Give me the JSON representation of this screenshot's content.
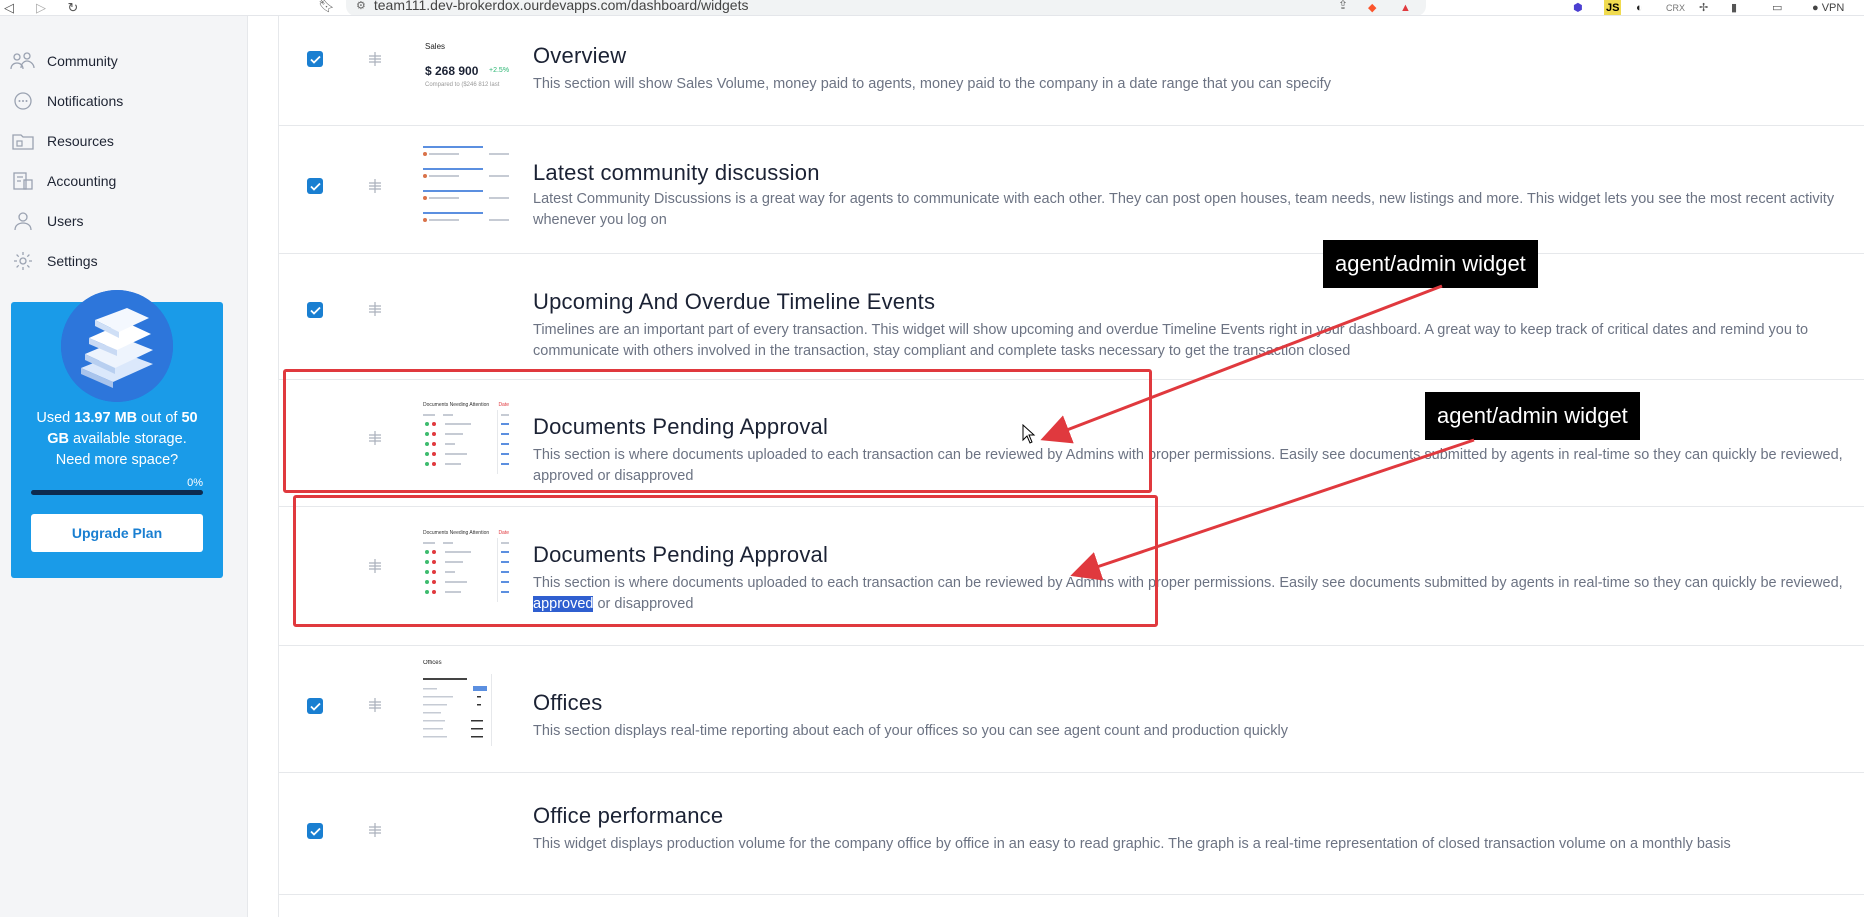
{
  "browser": {
    "url": "team111.dev-brokerdox.ourdevapps.com/dashboard/widgets",
    "vpn_label": "VPN",
    "js_badge": "JS",
    "crx_badge": "CRX"
  },
  "sidebar": {
    "items": [
      {
        "label": "Community",
        "icon": "community-icon"
      },
      {
        "label": "Notifications",
        "icon": "notifications-icon"
      },
      {
        "label": "Resources",
        "icon": "resources-icon"
      },
      {
        "label": "Accounting",
        "icon": "accounting-icon"
      },
      {
        "label": "Users",
        "icon": "users-icon"
      },
      {
        "label": "Settings",
        "icon": "settings-icon"
      }
    ],
    "storage": {
      "prefix": "Used ",
      "used": "13.97 MB",
      "middle": " out of ",
      "total": "50 GB",
      "suffix": " available storage.",
      "need_more": "Need more space?",
      "percent_label": "0%",
      "percent_value": 0,
      "upgrade_label": "Upgrade Plan"
    }
  },
  "widgets": [
    {
      "title": "Overview",
      "description": "This section will show Sales Volume, money paid to agents, money paid to the company in a date range that you can specify",
      "checked": true,
      "thumb": {
        "label": "Sales",
        "value": "$ 268 900",
        "change": "+2.5%",
        "compare": "Compared to ($246 812 last"
      }
    },
    {
      "title": "Latest community discussion",
      "description": "Latest Community Discussions is a great way for agents to communicate with each other. They can post open houses, team needs, new listings and more. This widget lets you see the most recent activity whenever you log on",
      "checked": true
    },
    {
      "title": "Upcoming And Overdue Timeline Events",
      "description": "Timelines are an important part of every transaction. This widget will show upcoming and overdue Timeline Events right in your dashboard. A great way to keep track of critical dates and remind you to communicate with others involved in the transaction, stay compliant and complete tasks necessary to get the transaction closed",
      "checked": true
    },
    {
      "title": "Documents Pending Approval",
      "description": "This section is where documents uploaded to each transaction can be reviewed by Admins with proper permissions. Easily see documents submitted by agents in real-time so they can quickly be reviewed, approved or disapproved",
      "checked": false
    },
    {
      "title": "Documents Pending Approval",
      "description_before": "This section is where documents uploaded to each transaction can be reviewed by Admins with proper permissions. Easily see documents submitted by agents in real-time so they can quickly be reviewed, ",
      "description_highlight": "approved",
      "description_after": " or disapproved",
      "checked": false
    },
    {
      "title": "Offices",
      "description": "This section displays real-time reporting about each of your offices so you can see agent count and production quickly",
      "checked": true,
      "thumb": {
        "label": "Offices"
      }
    },
    {
      "title": "Office performance",
      "description": "This widget displays production volume for the company office by office in an easy to read graphic. The graph is a real-time representation of closed transaction volume on a monthly basis",
      "checked": true
    }
  ],
  "thumb_doc": {
    "label": "Documents Needing Attention",
    "tag": "Date"
  },
  "annotations": [
    {
      "text": "agent/admin widget"
    },
    {
      "text": "agent/admin widget"
    }
  ],
  "colors": {
    "accent": "#1a7fd1",
    "storage_card": "#1a9be8",
    "annotation_red": "#e0393e"
  }
}
